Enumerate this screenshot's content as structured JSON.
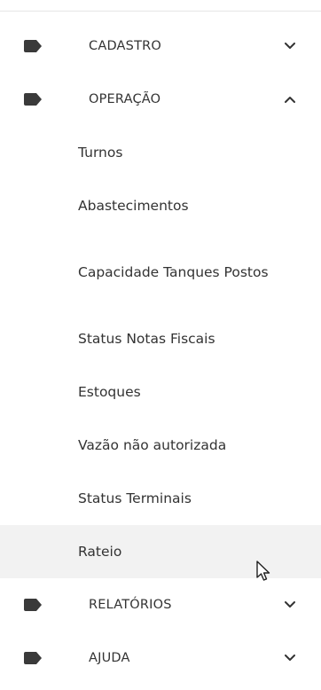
{
  "menu": {
    "sections": [
      {
        "label": "CADASTRO",
        "icon": "tag-icon",
        "state": "collapsed"
      },
      {
        "label": "OPERAÇÃO",
        "icon": "tag-icon",
        "state": "expanded",
        "items": [
          {
            "label": "Turnos"
          },
          {
            "label": "Abastecimentos"
          },
          {
            "label": "Capacidade Tanques Postos"
          },
          {
            "label": "Status Notas Fiscais"
          },
          {
            "label": "Estoques"
          },
          {
            "label": "Vazão não autorizada"
          },
          {
            "label": "Status Terminais"
          },
          {
            "label": "Rateio",
            "active": true
          }
        ]
      },
      {
        "label": "RELATÓRIOS",
        "icon": "tag-icon",
        "state": "collapsed"
      },
      {
        "label": "AJUDA",
        "icon": "tag-icon",
        "state": "collapsed"
      }
    ]
  },
  "colors": {
    "text": "#333333",
    "icon": "#3a3a3a",
    "active_bg": "#f2f2f2",
    "divider": "#e6e6e6"
  }
}
